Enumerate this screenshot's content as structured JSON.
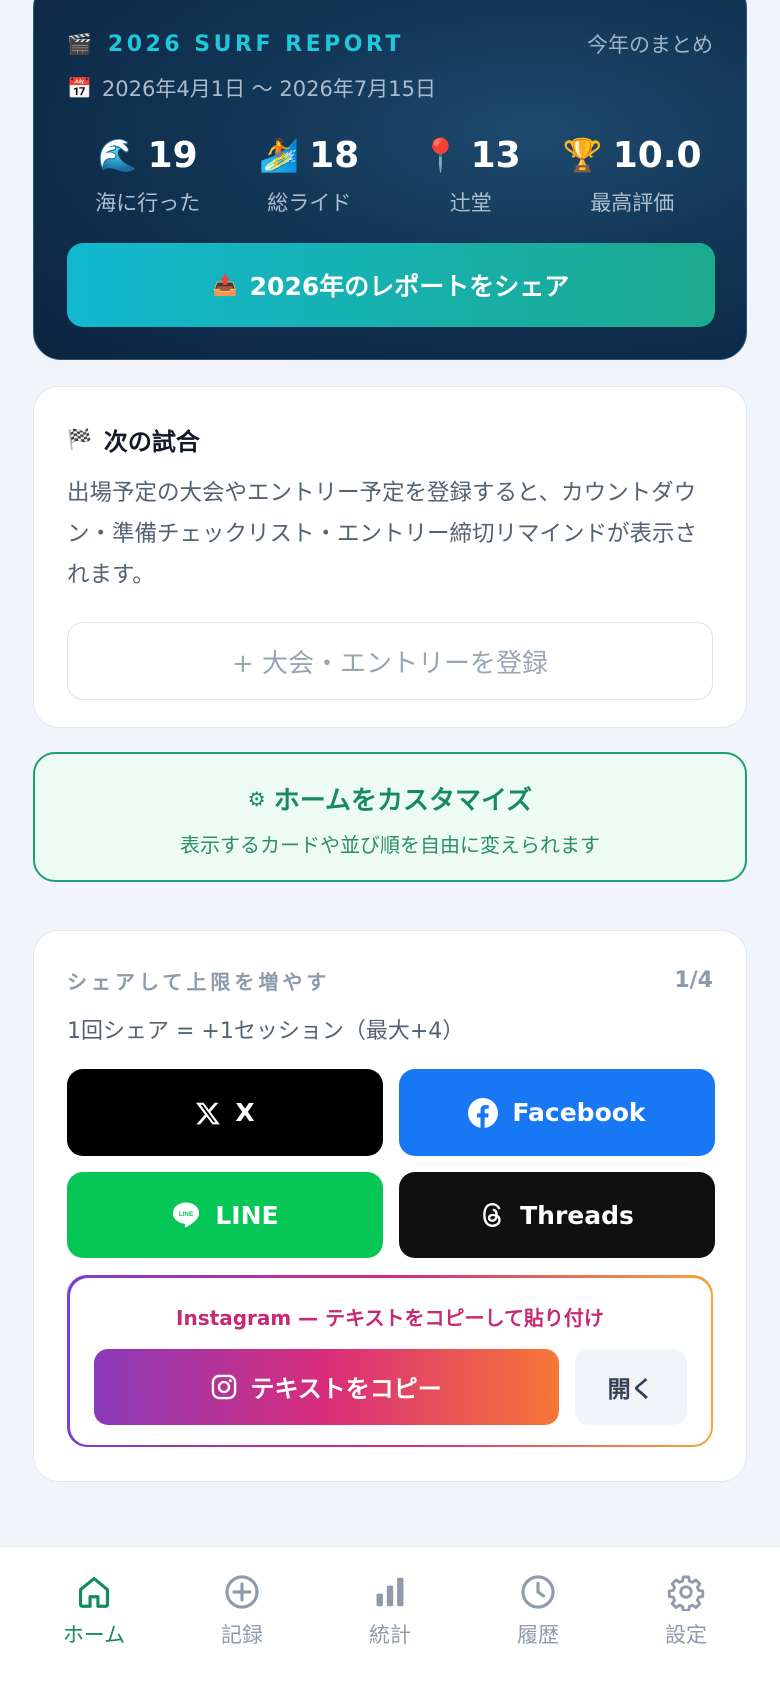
{
  "report": {
    "tag": "2026 SURF REPORT",
    "summary_label": "今年のまとめ",
    "period": "2026年4月1日 〜 2026年7月15日",
    "stats": [
      {
        "icon": "🌊",
        "value": "19",
        "label": "海に行った"
      },
      {
        "icon": "🏄",
        "value": "18",
        "label": "総ライド"
      },
      {
        "icon": "📍",
        "value": "13",
        "label": "辻堂"
      },
      {
        "icon": "🏆",
        "value": "10.0",
        "label": "最高評価"
      }
    ],
    "share_button": "2026年のレポートをシェア"
  },
  "next_match": {
    "title": "次の試合",
    "description": "出場予定の大会やエントリー予定を登録すると、カウントダウン・準備チェックリスト・エントリー締切リマインドが表示されます。",
    "add_button": "+ 大会・エントリーを登録"
  },
  "customize": {
    "title": "ホームをカスタマイズ",
    "subtitle": "表示するカードや並び順を自由に変えられます"
  },
  "share": {
    "title": "シェアして上限を増やす",
    "count": "1/4",
    "description": "1回シェア = +1セッション（最大+4）",
    "buttons": {
      "x": "X",
      "facebook": "Facebook",
      "line": "LINE",
      "threads": "Threads"
    },
    "instagram": {
      "title": "Instagram — テキストをコピーして貼り付け",
      "copy_button": "テキストをコピー",
      "open_button": "開く"
    }
  },
  "nav": [
    {
      "label": "ホーム",
      "active": true
    },
    {
      "label": "記録",
      "active": false
    },
    {
      "label": "統計",
      "active": false
    },
    {
      "label": "履歴",
      "active": false
    },
    {
      "label": "設定",
      "active": false
    }
  ],
  "colors": {
    "accent": "#168a66",
    "cyan": "#22c6d8",
    "background": "#f1f4f8"
  }
}
